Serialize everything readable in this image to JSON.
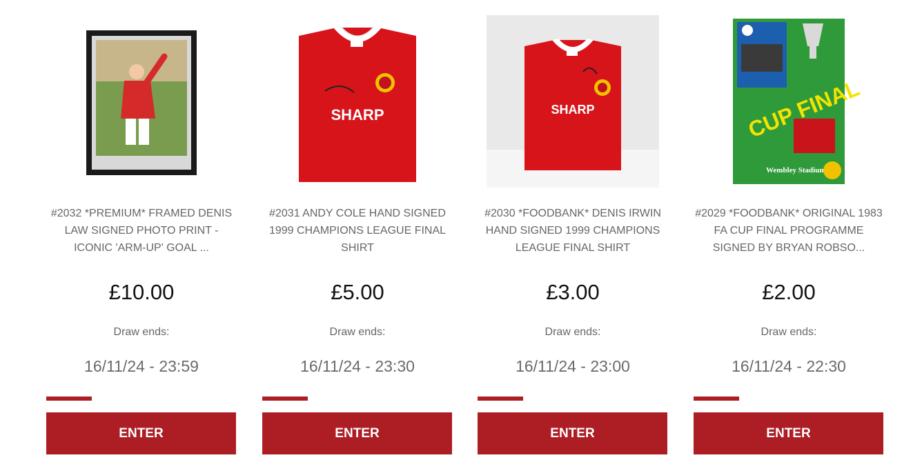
{
  "colors": {
    "accent": "#ac1e23",
    "shirt_red": "#d7141a",
    "title_gray": "#666666"
  },
  "draw_label": "Draw ends:",
  "cards": [
    {
      "title": "#2032 *PREMIUM* FRAMED DENIS LAW SIGNED PHOTO PRINT - ICONIC 'ARM-UP' GOAL ...",
      "price": "£10.00",
      "draw_ends": "16/11/24 - 23:59",
      "button_label": "ENTER",
      "progress": 0.24,
      "image": "framed-photo"
    },
    {
      "title": "#2031 ANDY COLE HAND SIGNED 1999 CHAMPIONS LEAGUE FINAL SHIRT",
      "price": "£5.00",
      "draw_ends": "16/11/24 - 23:30",
      "button_label": "ENTER",
      "progress": 0.24,
      "image": "signed-shirt",
      "sponsor": "SHARP"
    },
    {
      "title": "#2030 *FOODBANK* DENIS IRWIN HAND SIGNED 1999 CHAMPIONS LEAGUE FINAL SHIRT",
      "price": "£3.00",
      "draw_ends": "16/11/24 - 23:00",
      "button_label": "ENTER",
      "progress": 0.24,
      "image": "signed-shirt-studio",
      "sponsor": "SHARP"
    },
    {
      "title": "#2029 *FOODBANK* ORIGINAL 1983 FA CUP FINAL PROGRAMME SIGNED BY BRYAN ROBSO...",
      "price": "£2.00",
      "draw_ends": "16/11/24 - 22:30",
      "button_label": "ENTER",
      "progress": 0.24,
      "image": "cup-final-programme",
      "programme_text": [
        "CUP FINAL",
        "Wembley Stadium"
      ]
    }
  ]
}
